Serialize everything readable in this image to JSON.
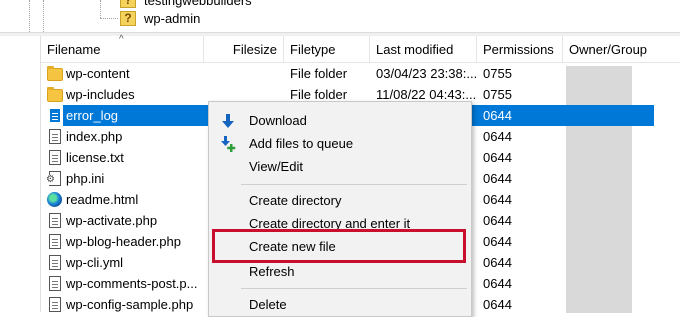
{
  "tree": {
    "items": [
      {
        "label": "testingwebbuilders"
      },
      {
        "label": "wp-admin"
      }
    ]
  },
  "columns": {
    "filename": "Filename",
    "filesize": "Filesize",
    "filetype": "Filetype",
    "last_modified": "Last modified",
    "permissions": "Permissions",
    "owner_group": "Owner/Group"
  },
  "files": [
    {
      "name": "wp-content",
      "type": "File folder",
      "modified": "03/04/23 23:38:...",
      "perms": "0755",
      "icon": "folder-icon"
    },
    {
      "name": "wp-includes",
      "type": "File folder",
      "modified": "11/08/22 04:43:...",
      "perms": "0755",
      "icon": "folder-icon"
    },
    {
      "name": "error_log",
      "type": "",
      "modified": "",
      "perms": "0644",
      "icon": "document-icon",
      "selected": true
    },
    {
      "name": "index.php",
      "type": "",
      "modified": "",
      "perms": "0644",
      "icon": "document-icon"
    },
    {
      "name": "license.txt",
      "type": "",
      "modified": "",
      "perms": "0644",
      "icon": "document-icon"
    },
    {
      "name": "php.ini",
      "type": "",
      "modified": "",
      "perms": "0644",
      "icon": "settings-file-icon"
    },
    {
      "name": "readme.html",
      "type": "",
      "modified": "",
      "perms": "0644",
      "icon": "edge-browser-icon"
    },
    {
      "name": "wp-activate.php",
      "type": "",
      "modified": "",
      "perms": "0644",
      "icon": "document-icon"
    },
    {
      "name": "wp-blog-header.php",
      "type": "",
      "modified": "",
      "perms": "0644",
      "icon": "document-icon"
    },
    {
      "name": "wp-cli.yml",
      "type": "",
      "modified": "",
      "perms": "0644",
      "icon": "document-icon"
    },
    {
      "name": "wp-comments-post.p...",
      "type": "",
      "modified": "",
      "perms": "0644",
      "icon": "document-icon"
    },
    {
      "name": "wp-config-sample.php",
      "type": "",
      "modified": "",
      "perms": "0644",
      "icon": "document-icon"
    }
  ],
  "context_menu": {
    "download": "Download",
    "add_to_queue": "Add files to queue",
    "view_edit": "View/Edit",
    "create_directory": "Create directory",
    "create_directory_enter": "Create directory and enter it",
    "create_new_file": "Create new file",
    "refresh": "Refresh",
    "delete": "Delete"
  },
  "colors": {
    "selection": "#0078d7",
    "highlight_box": "#c8102e",
    "download_arrow": "#1565c0",
    "queue_plus": "#2e9e3a"
  }
}
